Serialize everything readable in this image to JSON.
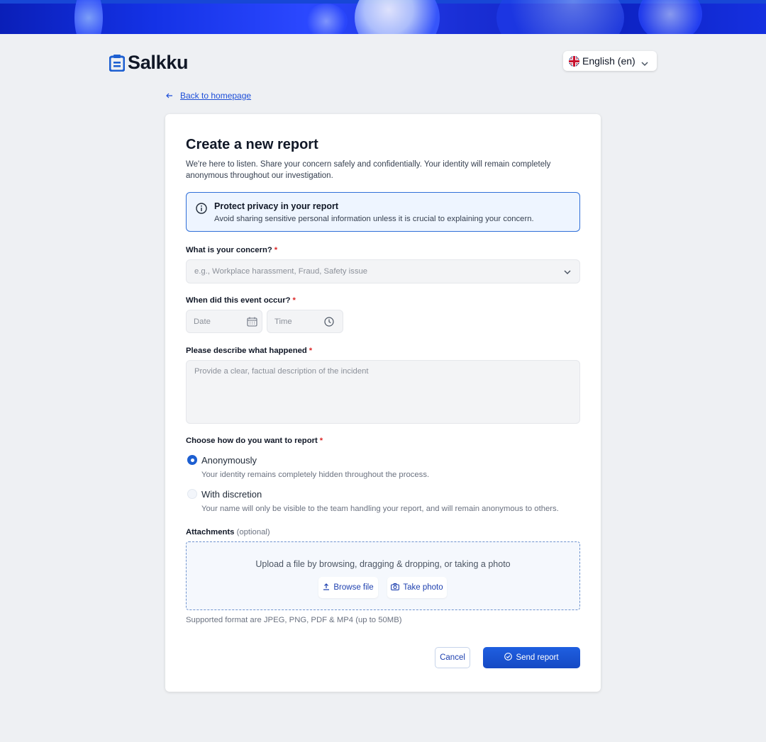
{
  "header": {
    "brand": "Salkku",
    "language": "English (en)"
  },
  "nav": {
    "back_label": "Back to homepage"
  },
  "form": {
    "title": "Create a new report",
    "intro": "We're here to listen. Share your concern safely and confidentially. Your identity will remain completely anonymous throughout our investigation.",
    "notice": {
      "title": "Protect privacy in your report",
      "text": "Avoid sharing sensitive personal information unless it is crucial to explaining your concern."
    },
    "concern": {
      "label": "What is your concern?",
      "required": "*",
      "placeholder": "e.g., Workplace harassment, Fraud, Safety issue"
    },
    "when": {
      "label": "When did this event occur?",
      "required": "*",
      "date_placeholder": "Date",
      "time_placeholder": "Time"
    },
    "describe": {
      "label": "Please describe what happened",
      "required": "*",
      "placeholder": "Provide a clear, factual description of the incident"
    },
    "report_mode": {
      "label": "Choose how do you want to report",
      "required": "*",
      "options": [
        {
          "title": "Anonymously",
          "desc": "Your identity remains completely hidden throughout the process.",
          "selected": true
        },
        {
          "title": "With discretion",
          "desc": "Your name will only be visible to the team handling your report, and will remain anonymous to others.",
          "selected": false
        }
      ]
    },
    "attachments": {
      "label": "Attachments",
      "optional": "(optional)",
      "drop_text": "Upload a file by browsing, dragging & dropping, or taking a photo",
      "browse_label": "Browse file",
      "photo_label": "Take photo",
      "hint": "Supported format are JPEG, PNG, PDF & MP4 (up to 50MB)"
    },
    "actions": {
      "cancel_label": "Cancel",
      "send_label": "Send report"
    }
  },
  "colors": {
    "accent": "#1d5fd1",
    "required": "#dc2626",
    "page_bg": "#eef0f3"
  }
}
